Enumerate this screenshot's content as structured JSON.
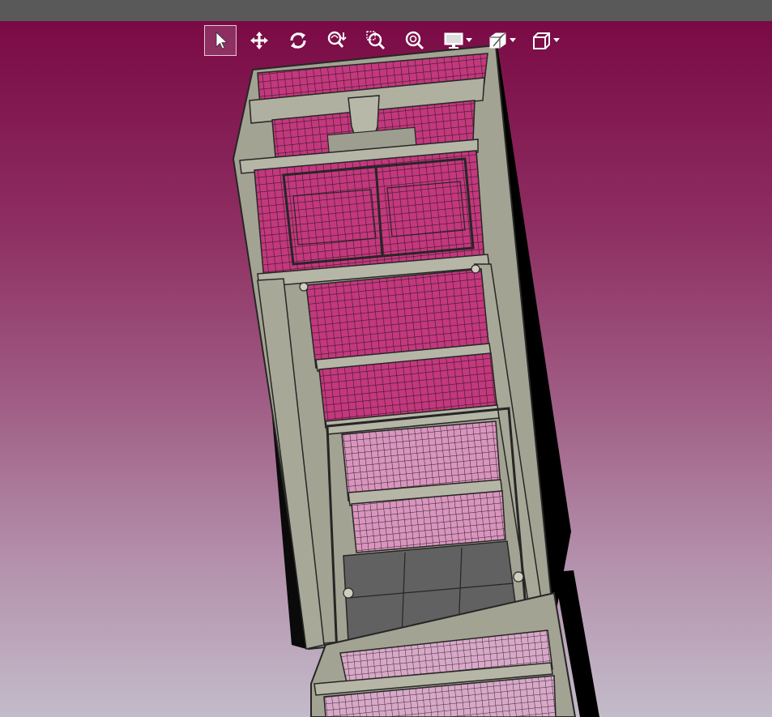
{
  "window": {
    "titlebar_color": "#595959"
  },
  "viewport": {
    "background_top": "#7a0a45",
    "background_bottom": "#c3bbca"
  },
  "toolbar": {
    "items": [
      {
        "id": "select",
        "icon": "arrow-pointer-icon",
        "active": true
      },
      {
        "id": "pan",
        "icon": "move-arrows-icon"
      },
      {
        "id": "rotate",
        "icon": "rotate-icon"
      },
      {
        "id": "zoom-dynamic",
        "icon": "zoom-dynamic-icon"
      },
      {
        "id": "zoom-window",
        "icon": "zoom-window-icon"
      },
      {
        "id": "zoom-fit",
        "icon": "zoom-fit-icon"
      },
      {
        "id": "display-mode",
        "icon": "monitor-icon",
        "dropdown": true
      },
      {
        "id": "section",
        "icon": "section-cube-icon",
        "dropdown": true
      },
      {
        "id": "view-orientation",
        "icon": "cube-icon",
        "dropdown": true
      }
    ]
  },
  "model": {
    "frame_color": "#a3a393",
    "mesh_color": "#c4387e",
    "panel_color": "#000000",
    "floor_color": "#616161"
  }
}
